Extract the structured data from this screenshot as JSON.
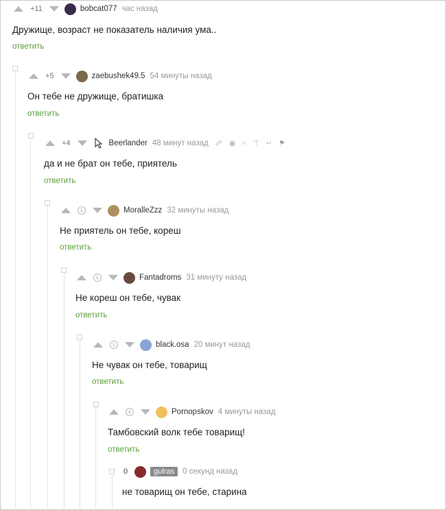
{
  "comments": [
    {
      "rating": "+11",
      "nick": "bobcat077",
      "time": "час назад",
      "text": "Дружище, возраст не показатель наличия ума..",
      "reply": "ответить"
    },
    {
      "rating": "+5",
      "nick": "zaebushek49.5",
      "time": "54 минуты назад",
      "text": "Он тебе не дружище, братишка",
      "reply": "ответить"
    },
    {
      "rating": "+4",
      "nick": "Beerlander",
      "time": "48 минут назад",
      "text": "да и не брат он тебе, приятель",
      "reply": "ответить"
    },
    {
      "nick": "MoralleZzz",
      "time": "32 минуты назад",
      "text": "Не приятель он тебе, кореш",
      "reply": "ответить"
    },
    {
      "nick": "Fantadroms",
      "time": "31 минуту назад",
      "text": "Не кореш он тебе, чувак",
      "reply": "ответить"
    },
    {
      "nick": "black.osa",
      "time": "20 минут назад",
      "text": "Не чувак он тебе, товарищ",
      "reply": "ответить"
    },
    {
      "nick": "Pornopskov",
      "time": "4 минуты назад",
      "text": "Тамбовский волк тебе товарищ!",
      "reply": "ответить"
    },
    {
      "rating": "0",
      "nick": "gulras",
      "time": "0 секунд назад",
      "text": "не товарищ он тебе, старина"
    }
  ],
  "icons": {
    "upvote": "arrow-up-icon",
    "downvote": "arrow-down-icon",
    "clock": "clock-icon",
    "link": "link-icon",
    "save": "save-icon",
    "share": "share-icon",
    "pin": "pin-icon",
    "flag": "flag-icon"
  },
  "colors": {
    "reply": "#5a9e3a",
    "arrows": "#b8b8b8",
    "badge": "#8a8a8a"
  }
}
